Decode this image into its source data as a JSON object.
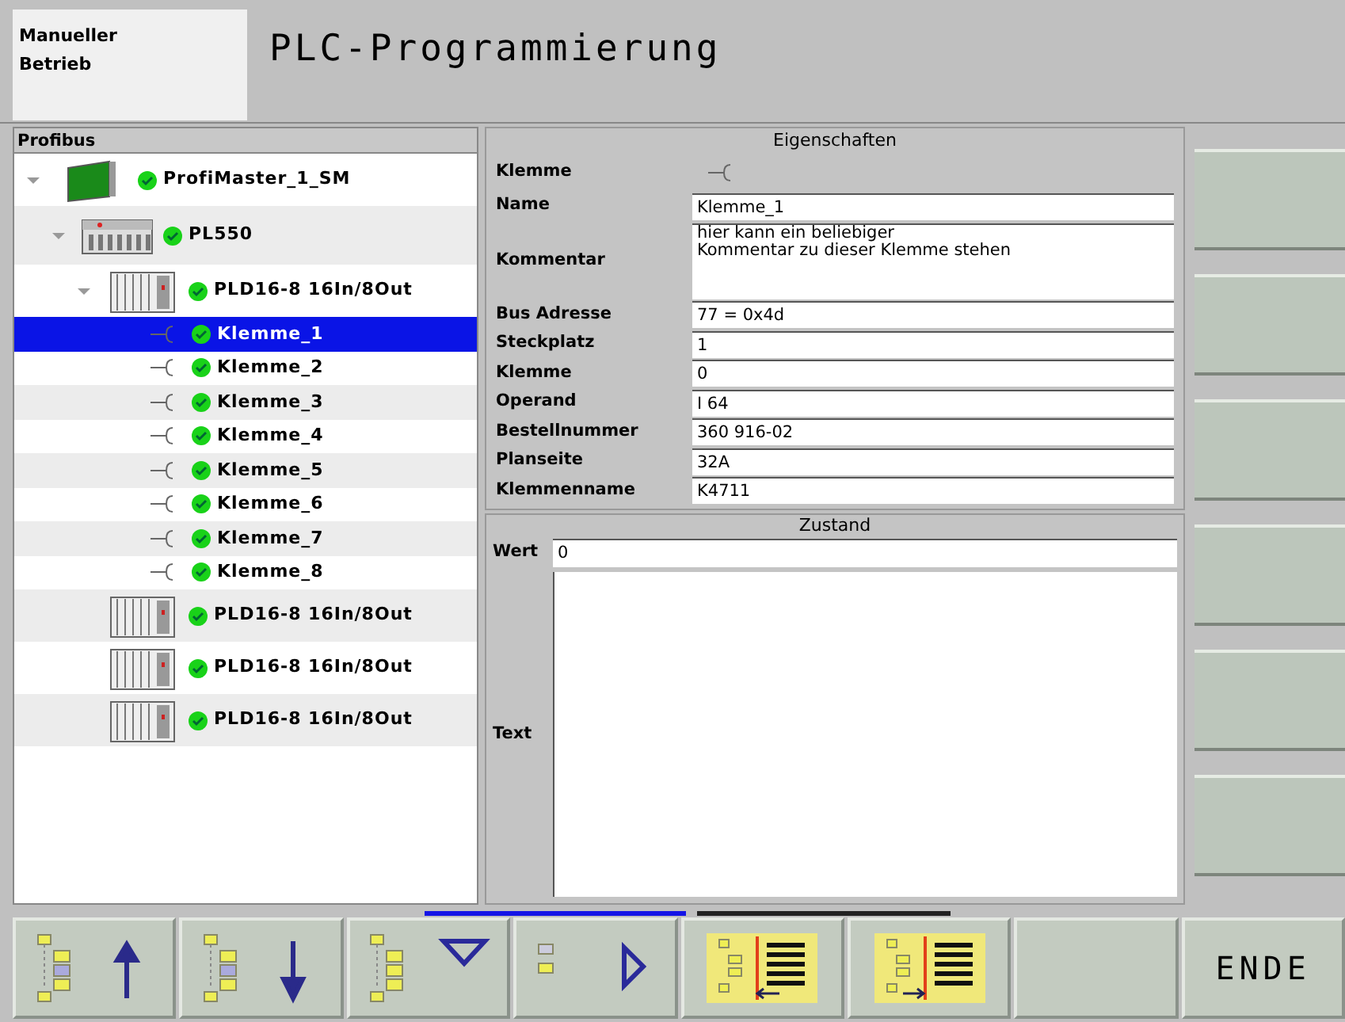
{
  "header": {
    "mode": "Manueller Betrieb",
    "title": "PLC-Programmierung"
  },
  "tree": {
    "title": "Profibus",
    "items": [
      {
        "label": "ProfiMaster_1_SM",
        "kind": "card",
        "expanded": true,
        "selected": false,
        "children": [
          {
            "label": "PL550",
            "kind": "controller",
            "expanded": true,
            "selected": false,
            "children": [
              {
                "label": "PLD16-8 16In/8Out",
                "kind": "module",
                "expanded": true,
                "selected": false,
                "children": [
                  {
                    "label": "Klemme_1",
                    "kind": "terminal",
                    "selected": true
                  },
                  {
                    "label": "Klemme_2",
                    "kind": "terminal",
                    "selected": false
                  },
                  {
                    "label": "Klemme_3",
                    "kind": "terminal",
                    "selected": false
                  },
                  {
                    "label": "Klemme_4",
                    "kind": "terminal",
                    "selected": false
                  },
                  {
                    "label": "Klemme_5",
                    "kind": "terminal",
                    "selected": false
                  },
                  {
                    "label": "Klemme_6",
                    "kind": "terminal",
                    "selected": false
                  },
                  {
                    "label": "Klemme_7",
                    "kind": "terminal",
                    "selected": false
                  },
                  {
                    "label": "Klemme_8",
                    "kind": "terminal",
                    "selected": false
                  }
                ]
              },
              {
                "label": "PLD16-8 16In/8Out",
                "kind": "module",
                "selected": false
              },
              {
                "label": "PLD16-8 16In/8Out",
                "kind": "module",
                "selected": false
              },
              {
                "label": "PLD16-8 16In/8Out",
                "kind": "module",
                "selected": false
              }
            ]
          }
        ]
      }
    ]
  },
  "properties": {
    "title": "Eigenschaften",
    "rows": [
      {
        "label": "Klemme",
        "kind": "icon"
      },
      {
        "label": "Name",
        "kind": "field",
        "value": "Klemme_1"
      },
      {
        "label": "Kommentar",
        "kind": "area",
        "value": "hier kann ein beliebiger\nKommentar zu dieser Klemme stehen"
      },
      {
        "label": "Bus Adresse",
        "kind": "field",
        "value": "77 = 0x4d"
      },
      {
        "label": "Steckplatz",
        "kind": "field",
        "value": "1"
      },
      {
        "label": "Klemme",
        "kind": "field",
        "value": "0"
      },
      {
        "label": "Operand",
        "kind": "field",
        "value": "I 64"
      },
      {
        "label": "Bestellnummer",
        "kind": "field",
        "value": "360 916-02"
      },
      {
        "label": "Planseite",
        "kind": "field",
        "value": "32A"
      },
      {
        "label": "Klemmenname",
        "kind": "field",
        "value": "K4711"
      }
    ]
  },
  "state": {
    "title": "Zustand",
    "value_label": "Wert",
    "value": "0",
    "text_label": "Text"
  },
  "toolbar": [
    {
      "kind": "tree-up"
    },
    {
      "kind": "tree-down"
    },
    {
      "kind": "collapse"
    },
    {
      "kind": "expand"
    },
    {
      "kind": "list-left"
    },
    {
      "kind": "list-right"
    },
    {
      "kind": "blank"
    },
    {
      "kind": "text",
      "label": "ENDE"
    }
  ]
}
